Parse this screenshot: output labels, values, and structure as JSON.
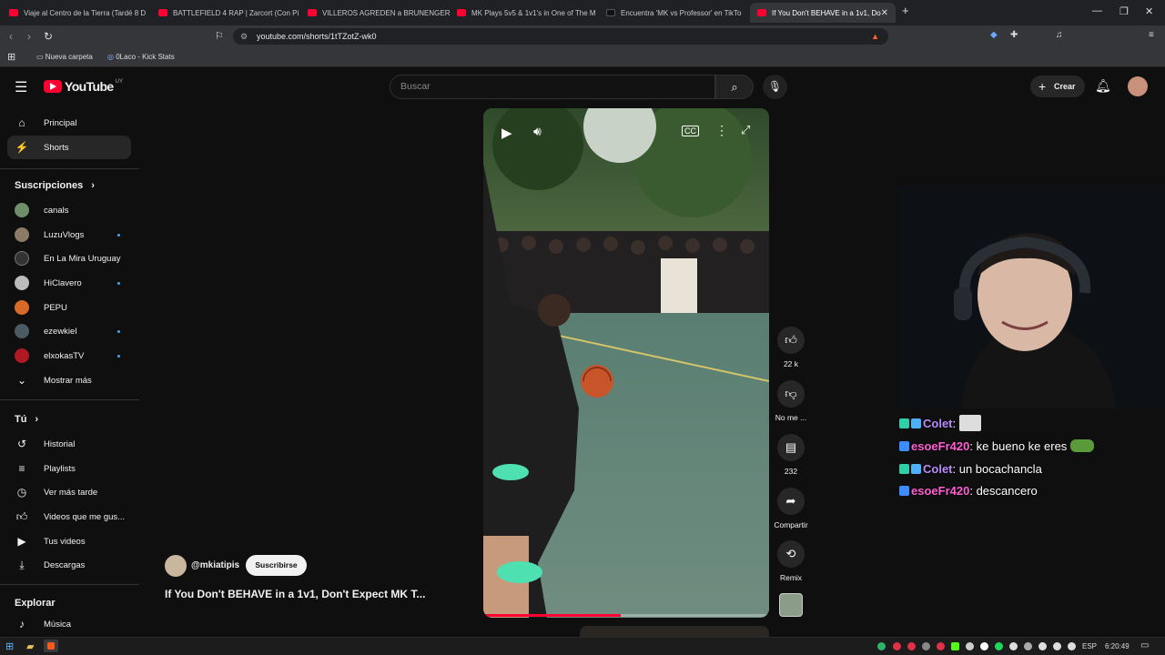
{
  "browser": {
    "tabs": [
      {
        "title": "Viaje al Centro de la Tierra (Tardé 8 D",
        "icon": "youtube-icon"
      },
      {
        "title": "BATTLEFIELD 4 RAP | Zarcort (Con Pi",
        "icon": "youtube-icon"
      },
      {
        "title": "VILLEROS AGREDEN a BRUNENGER y",
        "icon": "youtube-icon"
      },
      {
        "title": "MK Plays 5v5 & 1v1's in One of The M",
        "icon": "youtube-icon"
      },
      {
        "title": "Encuentra 'MK vs Professor' en TikTo",
        "icon": "tiktok-icon"
      },
      {
        "title": "If You Don't BEHAVE in a 1v1, Do",
        "icon": "youtube-icon"
      }
    ],
    "url": "youtube.com/shorts/1tTZotZ-wk0",
    "bookmarks": [
      "Nueva carpeta",
      "0Laco - Kick Stats"
    ]
  },
  "youtube": {
    "logo_text": "YouTube",
    "country": "UY",
    "search_placeholder": "Buscar",
    "create_label": "Crear",
    "sidebar": {
      "main": [
        {
          "label": "Principal",
          "icon": "home-icon"
        },
        {
          "label": "Shorts",
          "icon": "shorts-icon"
        }
      ],
      "subs_title": "Suscripciones",
      "subs": [
        {
          "label": "canals",
          "dot": false
        },
        {
          "label": "LuzuVlogs",
          "dot": true
        },
        {
          "label": "En La Mira Uruguay",
          "dot": false
        },
        {
          "label": "HiClavero",
          "dot": true
        },
        {
          "label": "PEPU",
          "dot": false
        },
        {
          "label": "ezewkiel",
          "dot": true
        },
        {
          "label": "elxokasTV",
          "dot": true
        }
      ],
      "show_more": "Mostrar más",
      "you_title": "Tú",
      "you": [
        {
          "label": "Historial",
          "icon": "history-icon"
        },
        {
          "label": "Playlists",
          "icon": "playlists-icon"
        },
        {
          "label": "Ver más tarde",
          "icon": "clock-icon"
        },
        {
          "label": "Videos que me gus...",
          "icon": "thumbs-up-icon"
        },
        {
          "label": "Tus videos",
          "icon": "video-icon"
        },
        {
          "label": "Descargas",
          "icon": "download-icon"
        }
      ],
      "explore_title": "Explorar",
      "explore": [
        {
          "label": "Música",
          "icon": "music-icon"
        }
      ]
    },
    "short": {
      "channel": "@mkiatipis",
      "subscribe": "Suscribirse",
      "title": "If You Don't BEHAVE in a 1v1, Don't Expect MK T...",
      "actions": {
        "likes": "22 k",
        "dislike": "No me ...",
        "comments": "232",
        "share": "Compartir",
        "remix": "Remix"
      },
      "progress": 0.48
    }
  },
  "chat": [
    {
      "user": "Colet",
      "user_color": "#b98cff",
      "message": "",
      "emote": true
    },
    {
      "user": "esoeFr420",
      "user_color": "#ff5fd2",
      "message": "ke bueno ke eres",
      "emote": true
    },
    {
      "user": "Colet",
      "user_color": "#b98cff",
      "message": "un bocachancla",
      "emote": false
    },
    {
      "user": "esoeFr420",
      "user_color": "#ff5fd2",
      "message": "descancero",
      "emote": false
    }
  ],
  "taskbar": {
    "lang": "ESP",
    "time": "6:20:49"
  }
}
